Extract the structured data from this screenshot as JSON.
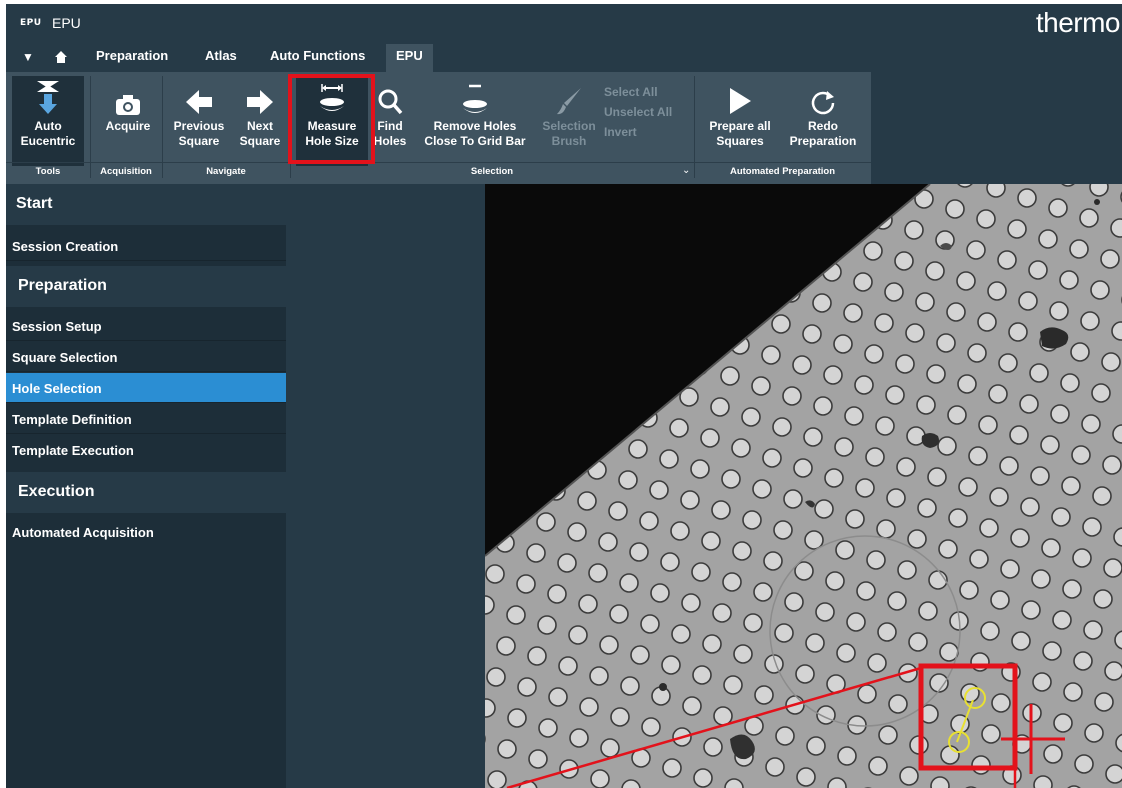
{
  "app": {
    "logo": "EPU",
    "title": "EPU",
    "brand": "thermo"
  },
  "tabs": [
    {
      "label": "Preparation"
    },
    {
      "label": "Atlas"
    },
    {
      "label": "Auto Functions"
    },
    {
      "label": "EPU",
      "active": true
    }
  ],
  "ribbon": {
    "buttons": {
      "auto_eucentric": [
        "Auto",
        "Eucentric"
      ],
      "acquire": [
        "Acquire"
      ],
      "previous_square": [
        "Previous",
        "Square"
      ],
      "next_square": [
        "Next",
        "Square"
      ],
      "measure_hole_size": [
        "Measure",
        "Hole Size"
      ],
      "find_holes": [
        "Find",
        "Holes"
      ],
      "remove_holes": [
        "Remove Holes",
        "Close To Grid Bar"
      ],
      "selection_brush": [
        "Selection",
        "Brush"
      ],
      "prepare_all": [
        "Prepare all",
        "Squares"
      ],
      "redo_preparation": [
        "Redo",
        "Preparation"
      ]
    },
    "select_menu": [
      "Select All",
      "Unselect All",
      "Invert"
    ],
    "groups": {
      "tools": "Tools",
      "acquisition": "Acquisition",
      "navigate": "Navigate",
      "selection": "Selection",
      "automated_preparation": "Automated Preparation"
    }
  },
  "sidebar": {
    "start": "Start",
    "session_creation": "Session Creation",
    "preparation": "Preparation",
    "session_setup": "Session Setup",
    "square_selection": "Square Selection",
    "hole_selection": "Hole Selection",
    "template_definition": "Template Definition",
    "template_execution": "Template Execution",
    "execution": "Execution",
    "automated_acquisition": "Automated Acquisition"
  },
  "colors": {
    "accent_selected": "#2b8ed3",
    "highlight": "#e3121b",
    "measure_marker": "#e8e032"
  },
  "icons": [
    "home-icon",
    "dropdown-arrow-icon",
    "eucentric-icon",
    "camera-icon",
    "arrow-left-icon",
    "arrow-right-icon",
    "measure-hole-icon",
    "search-icon",
    "remove-holes-icon",
    "brush-icon",
    "play-icon",
    "redo-icon"
  ]
}
